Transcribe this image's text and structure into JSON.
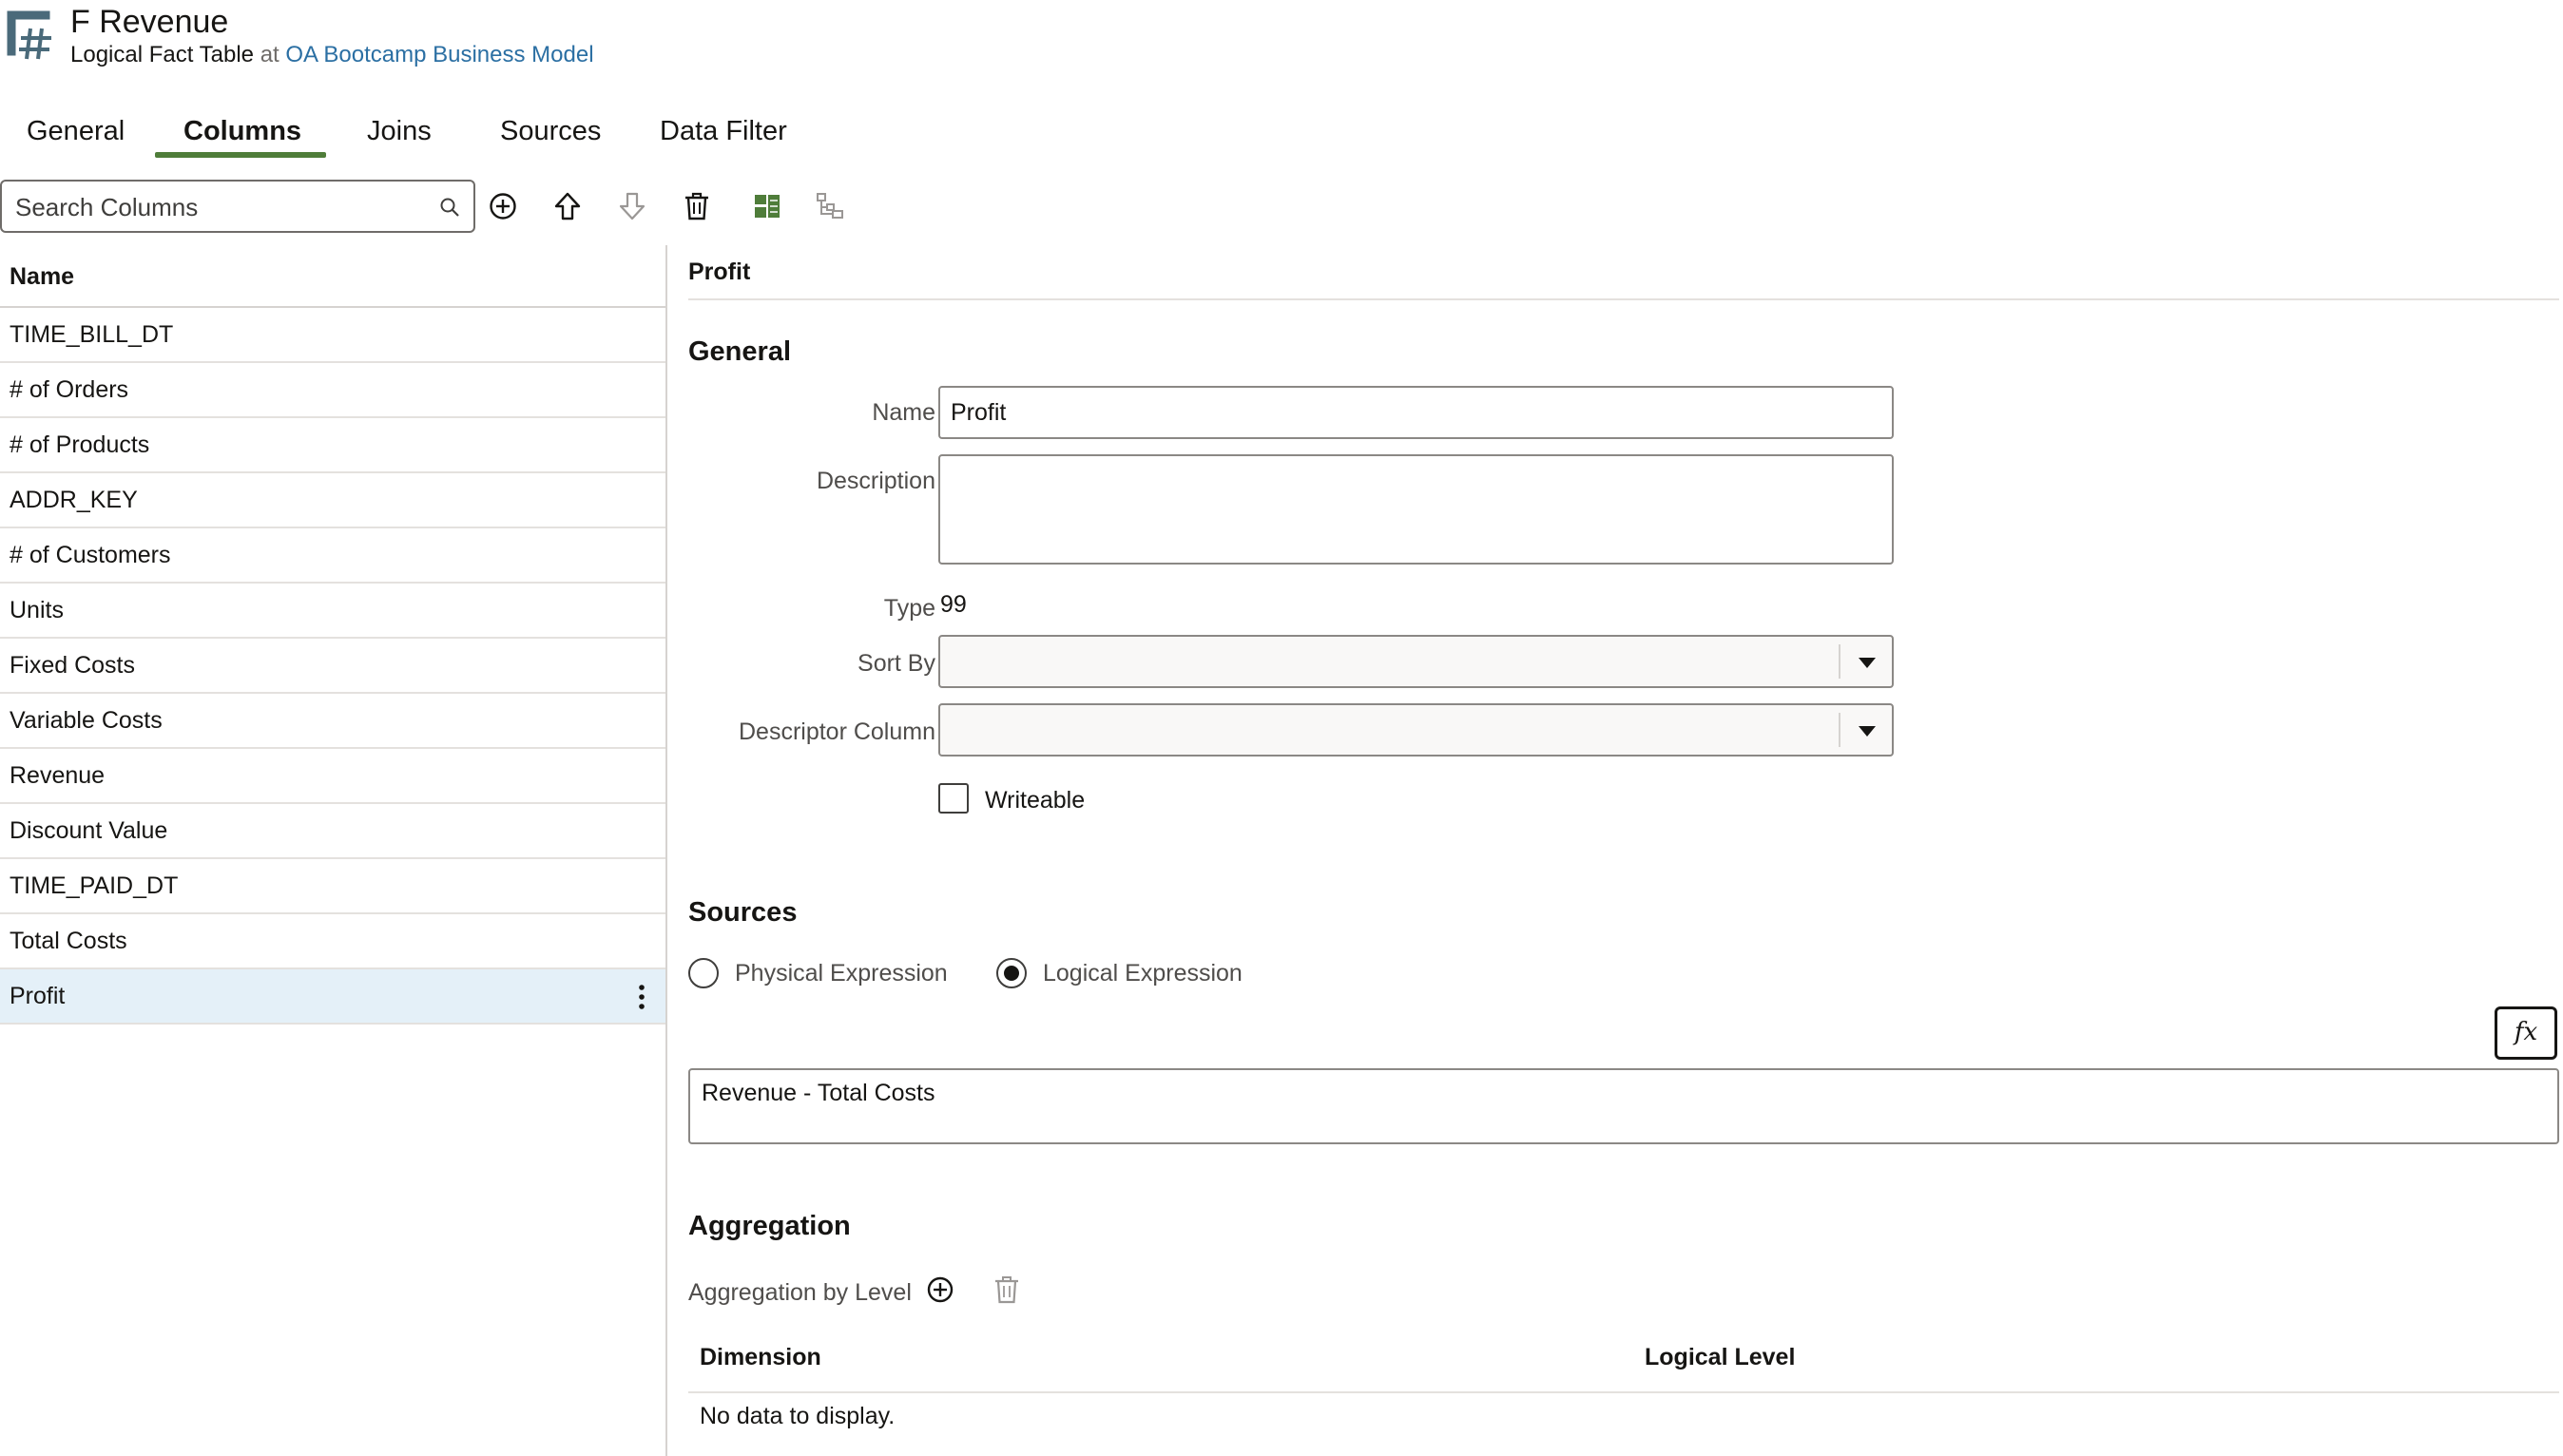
{
  "header": {
    "title": "F Revenue",
    "subtitle_type": "Logical Fact Table",
    "subtitle_at": "at",
    "subtitle_link": "OA Bootcamp Business Model",
    "icon": "logical-fact-table-icon"
  },
  "tabs": [
    {
      "label": "General",
      "active": false
    },
    {
      "label": "Columns",
      "active": true
    },
    {
      "label": "Joins",
      "active": false
    },
    {
      "label": "Sources",
      "active": false
    },
    {
      "label": "Data Filter",
      "active": false
    }
  ],
  "toolbar": {
    "search_placeholder": "Search Columns",
    "buttons": [
      "add-icon",
      "move-up-icon",
      "move-down-icon",
      "delete-icon",
      "columns-view-icon",
      "hierarchy-icon"
    ]
  },
  "columns_list": {
    "header": "Name",
    "items": [
      "TIME_BILL_DT",
      "# of Orders",
      "# of Products",
      "ADDR_KEY",
      "# of Customers",
      "Units",
      "Fixed Costs",
      "Variable Costs",
      "Revenue",
      "Discount Value",
      "TIME_PAID_DT",
      "Total Costs",
      "Profit"
    ],
    "selected": "Profit"
  },
  "detail": {
    "title": "Profit",
    "general": {
      "heading": "General",
      "name_label": "Name",
      "name_value": "Profit",
      "description_label": "Description",
      "description_value": "",
      "type_label": "Type",
      "type_value": "99",
      "sort_by_label": "Sort By",
      "sort_by_value": "",
      "descriptor_label": "Descriptor Column",
      "descriptor_value": "",
      "writeable_label": "Writeable",
      "writeable_checked": false
    },
    "sources": {
      "heading": "Sources",
      "option_physical": "Physical Expression",
      "option_logical": "Logical Expression",
      "selected": "Logical Expression",
      "fx_label": "fx",
      "expression": "Revenue - Total Costs"
    },
    "aggregation": {
      "heading": "Aggregation",
      "by_level_label": "Aggregation by Level",
      "columns": [
        "Dimension",
        "Logical Level"
      ],
      "empty_text": "No data to display."
    }
  },
  "colors": {
    "accent_green": "#4f7d3a",
    "link_blue": "#2b6fa3",
    "selected_row": "#e4f0f8",
    "icon_slate": "#4a6a7a"
  }
}
